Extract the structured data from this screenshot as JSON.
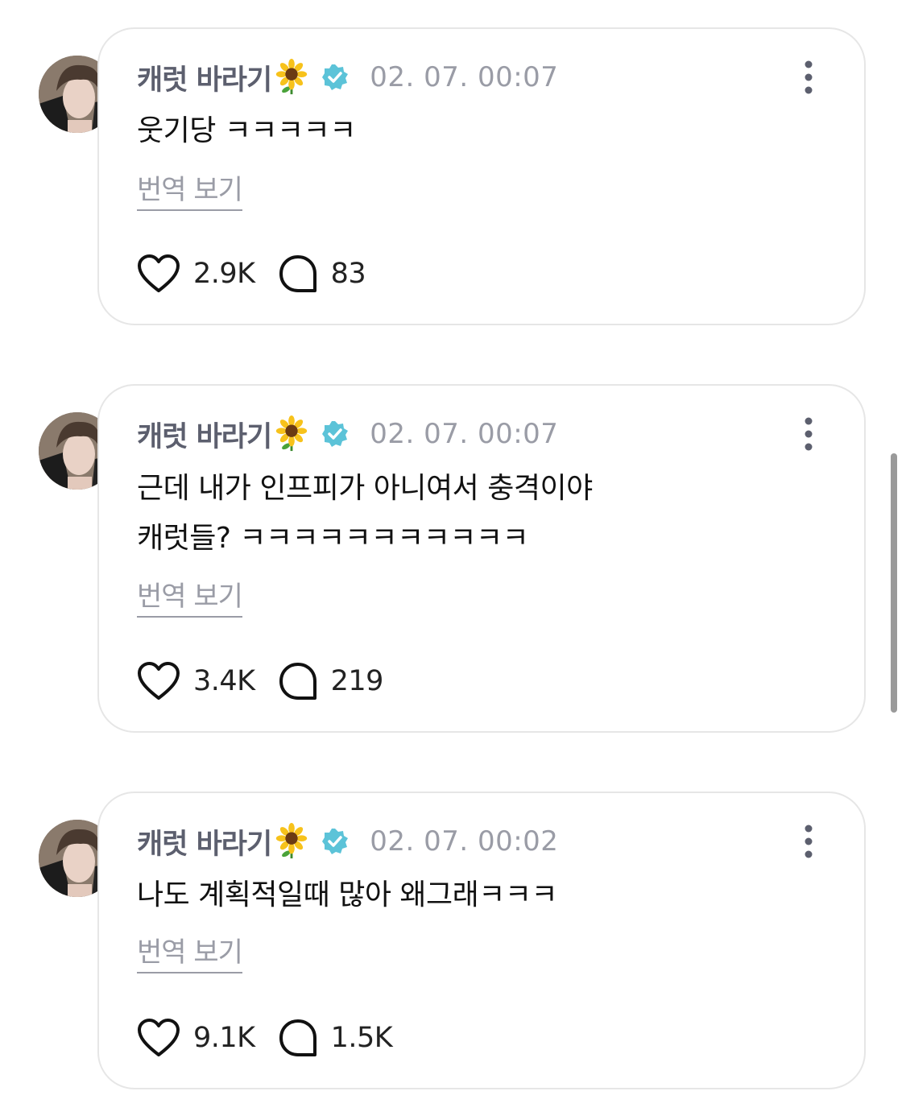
{
  "colors": {
    "author": "#5c5f6e",
    "timestamp": "#9a9ca6",
    "verified_badge": "#5cc3d8",
    "card_border": "#e6e6e6",
    "text": "#111111"
  },
  "icons": {
    "emoji": "sunflower-emoji",
    "badge": "verified-badge-icon",
    "more": "more-vertical-icon",
    "like": "heart-icon",
    "reply": "reply-bubble-icon"
  },
  "posts": [
    {
      "author": "캐럿 바라기",
      "timestamp": "02. 07. 00:07",
      "text": "웃기당 ㅋㅋㅋㅋㅋ",
      "translate_label": "번역 보기",
      "likes": "2.9K",
      "replies": "83"
    },
    {
      "author": "캐럿 바라기",
      "timestamp": "02. 07. 00:07",
      "text": "근데 내가 인프피가 아니여서 충격이야\n캐럿들? ㅋㅋㅋㅋㅋㅋㅋㅋㅋㅋㅋ",
      "translate_label": "번역 보기",
      "likes": "3.4K",
      "replies": "219"
    },
    {
      "author": "캐럿 바라기",
      "timestamp": "02. 07. 00:02",
      "text": "나도 계획적일때 많아 왜그래ㅋㅋㅋ",
      "translate_label": "번역 보기",
      "likes": "9.1K",
      "replies": "1.5K"
    }
  ]
}
